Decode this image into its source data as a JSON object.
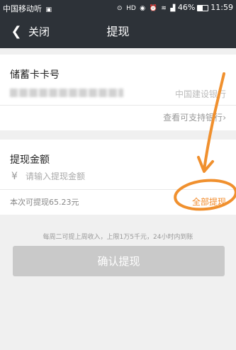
{
  "status_bar": {
    "carrier": "中国移动",
    "listen_glyph": "听",
    "battery_percent": "46%",
    "time": "11:59",
    "icons": [
      "location-icon",
      "hd-icon",
      "eye-icon",
      "alarm-icon",
      "wifi-icon",
      "signal-icon",
      "battery-icon"
    ]
  },
  "nav": {
    "back_label": "关闭",
    "title": "提现"
  },
  "bank_card": {
    "label": "储蓄卡卡号",
    "bank_name": "中国建设银行",
    "view_link": "查看可支持银行",
    "view_chevron": "›"
  },
  "amount": {
    "label": "提现金额",
    "currency_symbol": "¥",
    "placeholder": "请输入提现金额",
    "available_text": "本次可提现65.23元",
    "withdraw_all": "全部提现"
  },
  "tip": "每周二可提上周收入，上限1万5千元，24小时内到账",
  "confirm_label": "确认提现",
  "colors": {
    "nav_bg": "#2d3238",
    "accent_orange": "#f28b2b",
    "button_disabled": "#c9c9c9",
    "annotation_stroke": "#f0902e"
  }
}
